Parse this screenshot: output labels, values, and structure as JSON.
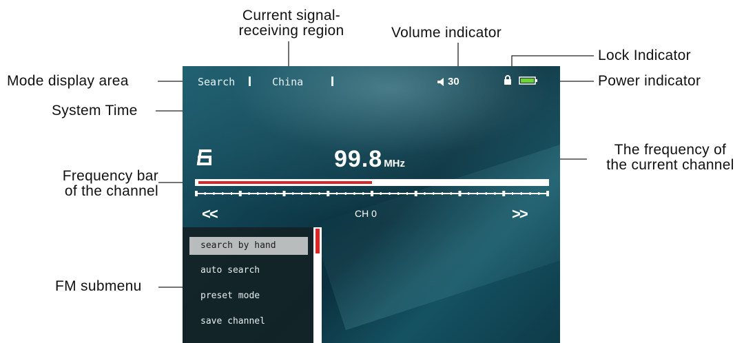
{
  "annotations": {
    "signal_region": "Current signal-\nreceiving region",
    "volume_indicator": "Volume indicator",
    "lock_indicator": "Lock Indicator",
    "power_indicator": "Power indicator",
    "mode_display_area": "Mode display area",
    "system_time": "System Time",
    "frequency_current_channel": "The frequency of\nthe current channel",
    "frequency_bar": "Frequency bar\nof the channel",
    "fm_submenu": "FM submenu"
  },
  "screen": {
    "status_bar": {
      "mode": "Search",
      "region": "China",
      "volume": "30",
      "lock_icon": "lock-icon",
      "battery_icon": "battery-icon",
      "battery_color": "#6fd23c"
    },
    "preset_number": "6",
    "frequency": {
      "value": "99.8",
      "unit": "MHz"
    },
    "frequency_bar_level": 0.5,
    "channel_label": "CH 0",
    "nav": {
      "prev": "<<",
      "next": ">>"
    },
    "submenu": {
      "items": [
        {
          "label": "search by hand",
          "selected": true
        },
        {
          "label": "auto search",
          "selected": false
        },
        {
          "label": "preset mode",
          "selected": false
        },
        {
          "label": "save channel",
          "selected": false
        }
      ]
    },
    "colors": {
      "accent_red": "#d62828",
      "bar_white": "#ffffff"
    }
  }
}
